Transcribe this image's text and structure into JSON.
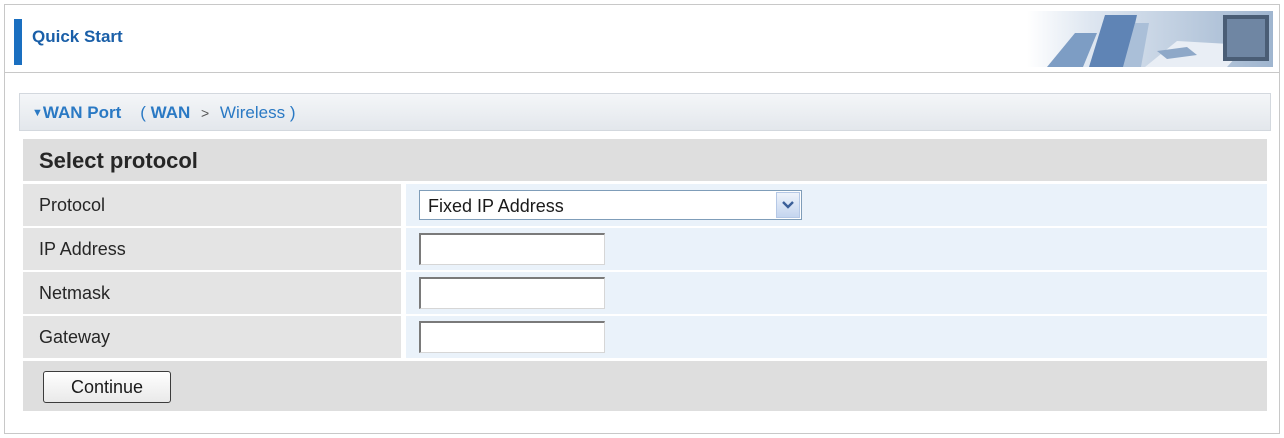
{
  "header": {
    "title": "Quick Start"
  },
  "section": {
    "title": "WAN Port",
    "breadcrumb": {
      "open": "(",
      "current": "WAN",
      "separator": ">",
      "next": "Wireless",
      "close": ")"
    }
  },
  "form": {
    "heading": "Select protocol",
    "protocol": {
      "label": "Protocol",
      "selected": "Fixed IP Address"
    },
    "ip_address": {
      "label": "IP Address",
      "value": ""
    },
    "netmask": {
      "label": "Netmask",
      "value": ""
    },
    "gateway": {
      "label": "Gateway",
      "value": ""
    },
    "continue_label": "Continue"
  },
  "icons": {
    "section_toggle": "triangle-down-icon",
    "select_arrow": "chevron-down-icon"
  },
  "colors": {
    "accent": "#1a6fc0",
    "title_text": "#1a5fa8",
    "section_text": "#2a79c4",
    "label_bg": "#e4e4e4",
    "value_bg": "#eaf2fa"
  }
}
